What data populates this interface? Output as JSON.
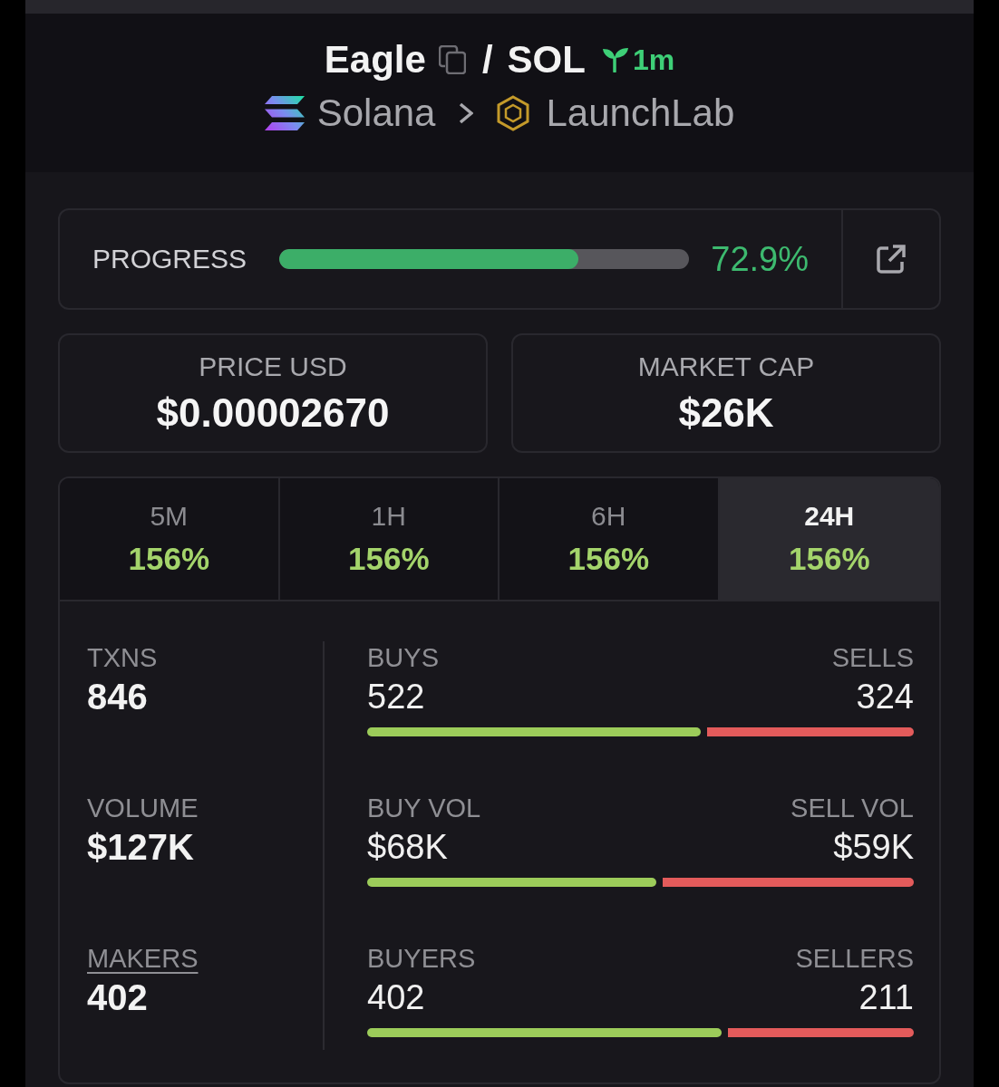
{
  "pair": {
    "token": "Eagle",
    "separator": "/",
    "quote": "SOL",
    "age": "1m"
  },
  "breadcrumb": [
    {
      "kind": "chain",
      "label": "Solana"
    },
    {
      "kind": "launchpad",
      "label": "LaunchLab"
    }
  ],
  "progress": {
    "label": "PROGRESS",
    "level": 0.729,
    "reading": "72.9%"
  },
  "metrics": [
    {
      "label": "PRICE USD",
      "value": "$0.00002670"
    },
    {
      "label": "MARKET CAP",
      "value": "$26K"
    }
  ],
  "timeframes": [
    {
      "label": "5M",
      "change": "156%",
      "selected": false
    },
    {
      "label": "1H",
      "change": "156%",
      "selected": false
    },
    {
      "label": "6H",
      "change": "156%",
      "selected": false
    },
    {
      "label": "24H",
      "change": "156%",
      "selected": true
    }
  ],
  "stats": [
    {
      "label": "TXNS",
      "value": "846",
      "underlined": false,
      "buy_label": "BUYS",
      "buy_value": "522",
      "sell_label": "SELLS",
      "sell_value": "324",
      "level": 0.617
    },
    {
      "label": "VOLUME",
      "value": "$127K",
      "underlined": false,
      "buy_label": "BUY VOL",
      "buy_value": "$68K",
      "sell_label": "SELL VOL",
      "sell_value": "$59K",
      "level": 0.535
    },
    {
      "label": "MAKERS",
      "value": "402",
      "underlined": true,
      "buy_label": "BUYERS",
      "buy_value": "402",
      "sell_label": "SELLERS",
      "sell_value": "211",
      "level": 0.656
    }
  ]
}
